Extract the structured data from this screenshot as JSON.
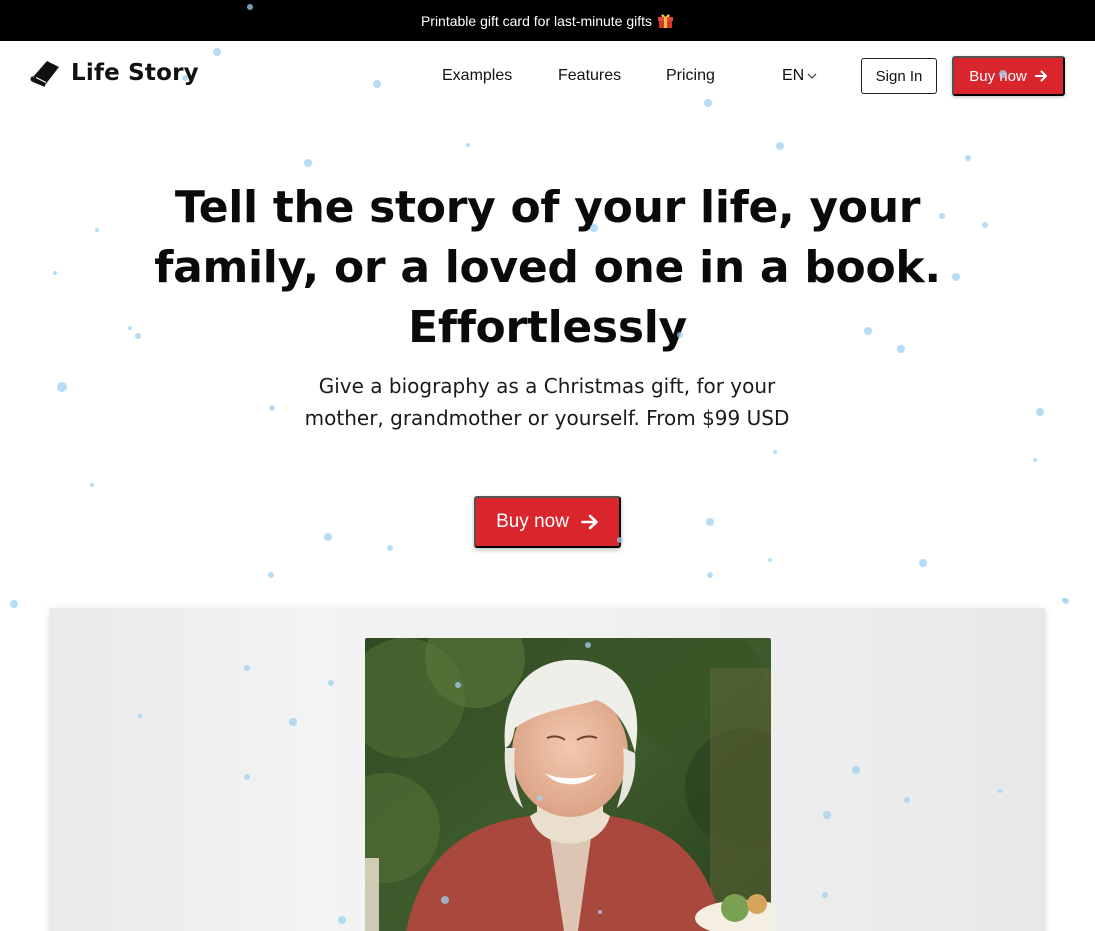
{
  "banner": {
    "text": "Printable gift card for last-minute gifts",
    "icon": "gift-icon"
  },
  "brand": {
    "name": "Life Story",
    "icon": "book-icon"
  },
  "nav": {
    "items": [
      {
        "label": "Examples"
      },
      {
        "label": "Features"
      },
      {
        "label": "Pricing"
      }
    ],
    "language": "EN",
    "language_icon": "chevron-down-icon",
    "sign_in": "Sign In",
    "buy_now": "Buy now",
    "buy_now_icon": "arrow-right-icon"
  },
  "hero": {
    "title": "Tell the story of your life, your family, or a loved one in a book. Effortlessly",
    "subtitle": "Give a biography as a Christmas gift, for your mother, grandmother or yourself. From $99 USD",
    "cta": "Buy now",
    "cta_icon": "arrow-right-icon"
  },
  "colors": {
    "accent": "#d8262c",
    "banner_bg": "#000000",
    "snow": "#9fd0f0"
  }
}
